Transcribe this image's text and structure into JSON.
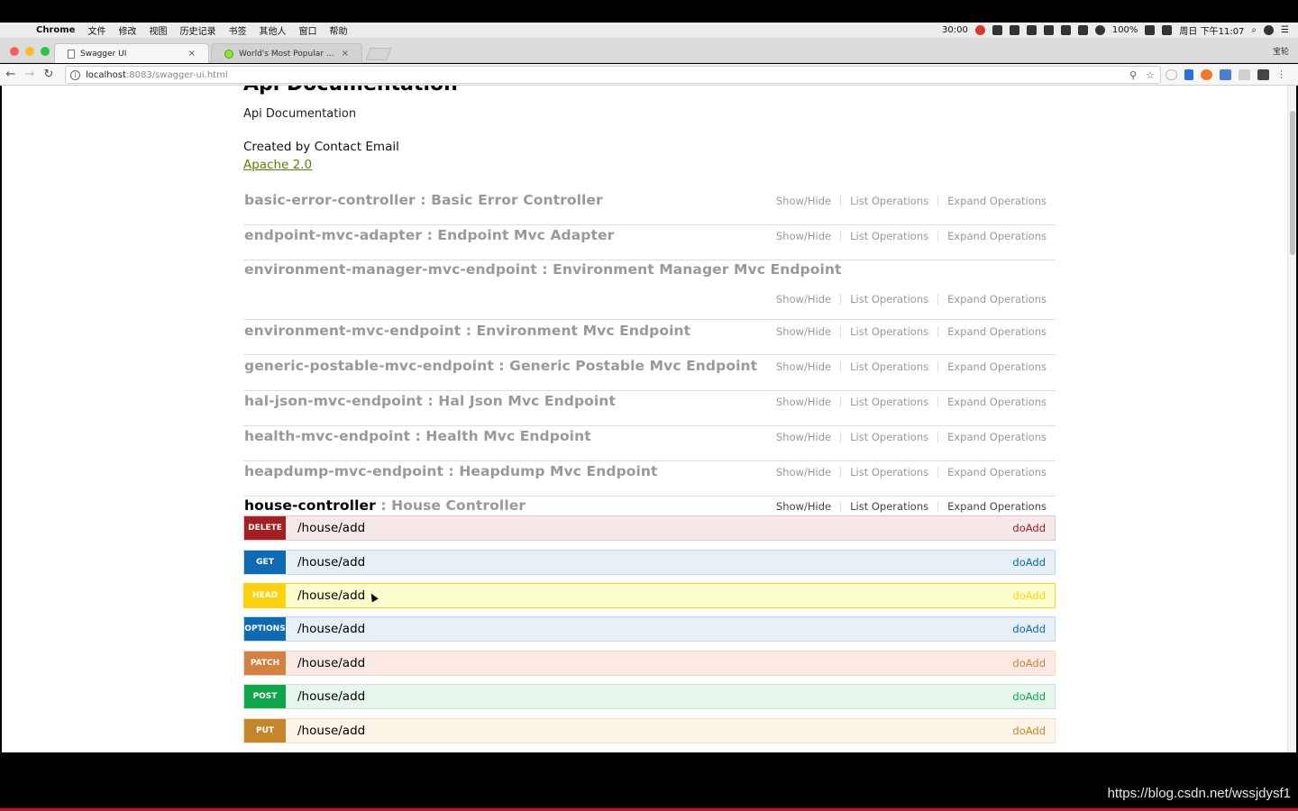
{
  "menubar": {
    "app": "Chrome",
    "items": [
      "文件",
      "修改",
      "视图",
      "历史记录",
      "书签",
      "其他人",
      "窗口",
      "帮助"
    ],
    "timer": "30:00",
    "battery": "100%",
    "clock": "周日 下午11:07"
  },
  "tabs": [
    {
      "title": "Swagger UI",
      "close": "×"
    },
    {
      "title": "World's Most Popular API Framework",
      "close": "×"
    }
  ],
  "profile": "宝轮",
  "address": {
    "host": "localhost",
    "path": ":8083/swagger-ui.html"
  },
  "doc": {
    "title": "Api Documentation",
    "description": "Api Documentation",
    "contact": "Created by Contact Email",
    "license": "Apache 2.0"
  },
  "resources": [
    {
      "name": "basic-error-controller",
      "desc": " : Basic Error Controller"
    },
    {
      "name": "endpoint-mvc-adapter",
      "desc": " : Endpoint Mvc Adapter"
    },
    {
      "name": "environment-manager-mvc-endpoint",
      "desc": " : Environment Manager Mvc Endpoint"
    },
    {
      "name": "environment-mvc-endpoint",
      "desc": " : Environment Mvc Endpoint"
    },
    {
      "name": "generic-postable-mvc-endpoint",
      "desc": " : Generic Postable Mvc Endpoint"
    },
    {
      "name": "hal-json-mvc-endpoint",
      "desc": " : Hal Json Mvc Endpoint"
    },
    {
      "name": "health-mvc-endpoint",
      "desc": " : Health Mvc Endpoint"
    },
    {
      "name": "heapdump-mvc-endpoint",
      "desc": " : Heapdump Mvc Endpoint"
    },
    {
      "name": "house-controller",
      "desc": " : House Controller"
    }
  ],
  "ops_labels": {
    "show_hide": "Show/Hide",
    "list": "List Operations",
    "expand": "Expand Operations"
  },
  "endpoints": [
    {
      "verb": "delete",
      "path": "/house/add",
      "summary": "doAdd"
    },
    {
      "verb": "get",
      "path": "/house/add",
      "summary": "doAdd"
    },
    {
      "verb": "head",
      "path": "/house/add",
      "summary": "doAdd"
    },
    {
      "verb": "options",
      "path": "/house/add",
      "summary": "doAdd"
    },
    {
      "verb": "patch",
      "path": "/house/add",
      "summary": "doAdd"
    },
    {
      "verb": "post",
      "path": "/house/add",
      "summary": "doAdd"
    },
    {
      "verb": "put",
      "path": "/house/add",
      "summary": "doAdd"
    }
  ],
  "verb_colors": {
    "delete": {
      "badge": "#a41e22",
      "bg": "#f5e8e8",
      "border": "#e8c6c7",
      "text": "#a41e22"
    },
    "get": {
      "badge": "#0f6ab4",
      "bg": "#e7f0f7",
      "border": "#c3d9ec",
      "text": "#0f6ab4"
    },
    "head": {
      "badge": "#ffd20f",
      "bg": "#fcffcd",
      "border": "#ffd20f",
      "text": "#ffd20f"
    },
    "options": {
      "badge": "#0f6ab4",
      "bg": "#e7f0f7",
      "border": "#c3d9ec",
      "text": "#0f6ab4"
    },
    "patch": {
      "badge": "#d38042",
      "bg": "#fce9e3",
      "border": "#f5d5c3",
      "text": "#d38042"
    },
    "post": {
      "badge": "#10a54a",
      "bg": "#e7f6ec",
      "border": "#c3e8d1",
      "text": "#10a54a"
    },
    "put": {
      "badge": "#c5862b",
      "bg": "#fcf4e6",
      "border": "#f0e0ca",
      "text": "#c5862b"
    }
  },
  "watermark": "https://blog.csdn.net/wssjdysf1"
}
